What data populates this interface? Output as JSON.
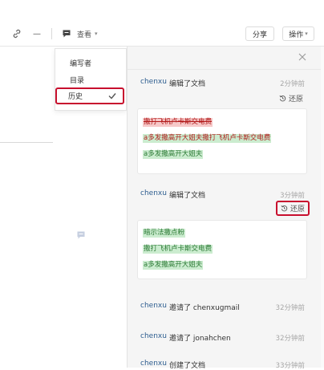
{
  "toolbar": {
    "link_icon": "link-icon",
    "minus_label": "—",
    "comment_icon": "comment-icon",
    "view_label": "查看",
    "view_caret": "▾",
    "share_label": "分享",
    "operate_label": "操作",
    "operate_caret": "▾"
  },
  "menu": {
    "items": [
      {
        "label": "编写者"
      },
      {
        "label": "目录"
      },
      {
        "label": "历史",
        "selected": true
      }
    ]
  },
  "history": {
    "close_icon": "close-icon",
    "restore_icon": "history-restore-icon",
    "entries": [
      {
        "user": "chenxu",
        "action": "编辑了文档",
        "time": "2分钟前",
        "restore": "还原",
        "diff": [
          {
            "text": "撒打飞机卢卡斯交电费",
            "type": "del"
          },
          {
            "text": "a多发撒高开大姐夫撒打飞机卢卡斯交电费",
            "type": "mixed"
          },
          {
            "text": "a多发撒高开大姐夫",
            "type": "add"
          }
        ]
      },
      {
        "user": "chenxu",
        "action": "编辑了文档",
        "time": "3分钟前",
        "restore": "还原",
        "diff": [
          {
            "text": "暗示法撒点粉",
            "type": "add"
          },
          {
            "text": "撒打飞机卢卡斯交电费",
            "type": "add"
          },
          {
            "text": "a多发撒高开大姐夫",
            "type": "add"
          }
        ]
      },
      {
        "user": "chenxu",
        "action": "邀请了 chenxugmail",
        "time": "32分钟前"
      },
      {
        "user": "chenxu",
        "action": "邀请了 jonahchen",
        "time": "32分钟前"
      },
      {
        "user": "chenxu",
        "action": "创建了文档",
        "time": "33分钟前"
      }
    ]
  }
}
